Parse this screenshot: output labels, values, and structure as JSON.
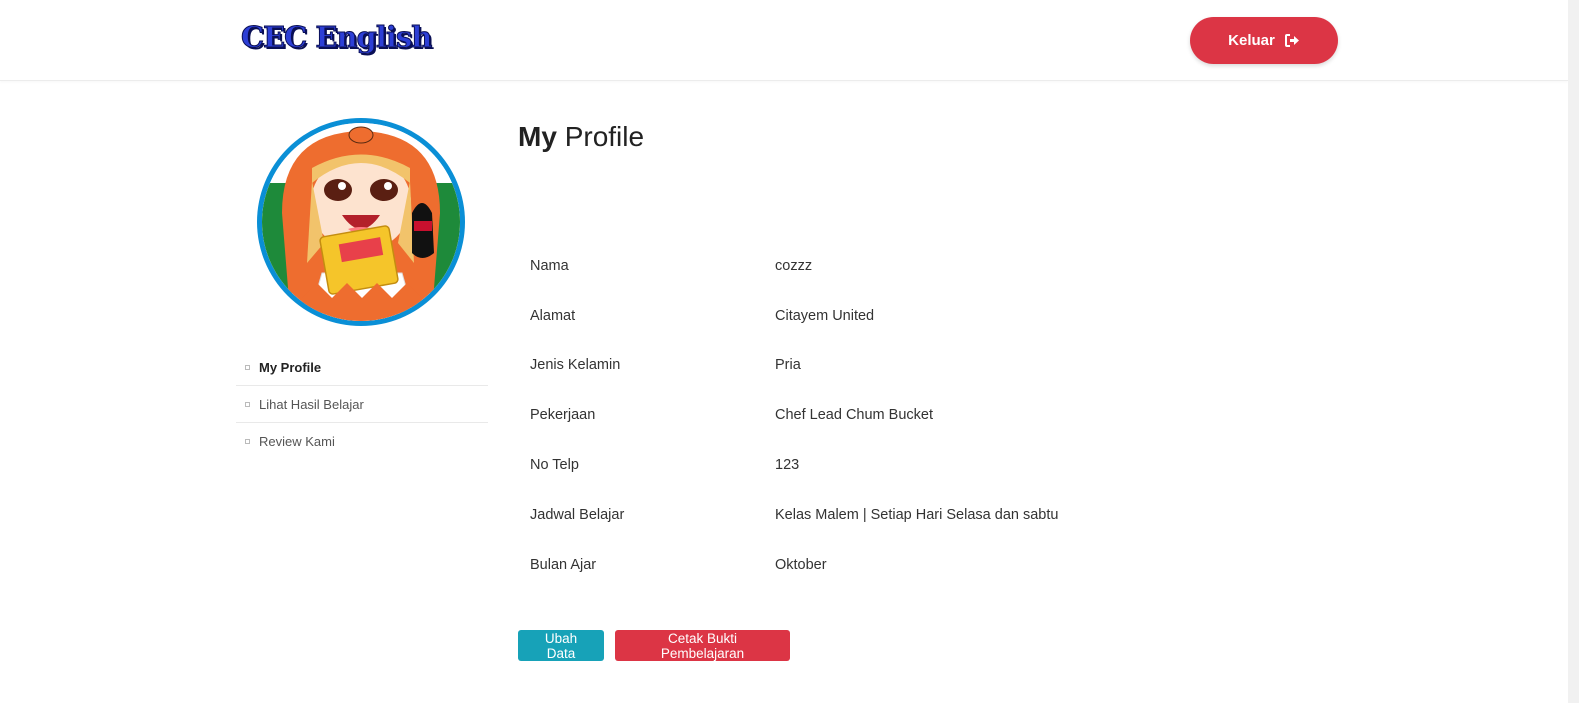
{
  "header": {
    "logo_text": "CEC English",
    "logout_label": "Keluar",
    "logout_icon": "sign-out-icon",
    "logout_color": "#dc3545"
  },
  "sidebar": {
    "avatar_ring_color": "#0a8fd6",
    "items": [
      {
        "label": "My Profile",
        "active": true
      },
      {
        "label": "Lihat Hasil Belajar",
        "active": false
      },
      {
        "label": "Review Kami",
        "active": false
      }
    ]
  },
  "main": {
    "title_bold": "My",
    "title_rest": "Profile",
    "rows": [
      {
        "key": "Nama",
        "value": "cozzz"
      },
      {
        "key": "Alamat",
        "value": "Citayem United"
      },
      {
        "key": "Jenis Kelamin",
        "value": "Pria"
      },
      {
        "key": "Pekerjaan",
        "value": "Chef Lead Chum Bucket"
      },
      {
        "key": "No Telp",
        "value": "123"
      },
      {
        "key": "Jadwal Belajar",
        "value": "Kelas Malem | Setiap Hari Selasa dan sabtu"
      },
      {
        "key": "Bulan Ajar",
        "value": "Oktober"
      }
    ],
    "edit_button": "Ubah Data",
    "print_button": "Cetak Bukti Pembelajaran"
  }
}
